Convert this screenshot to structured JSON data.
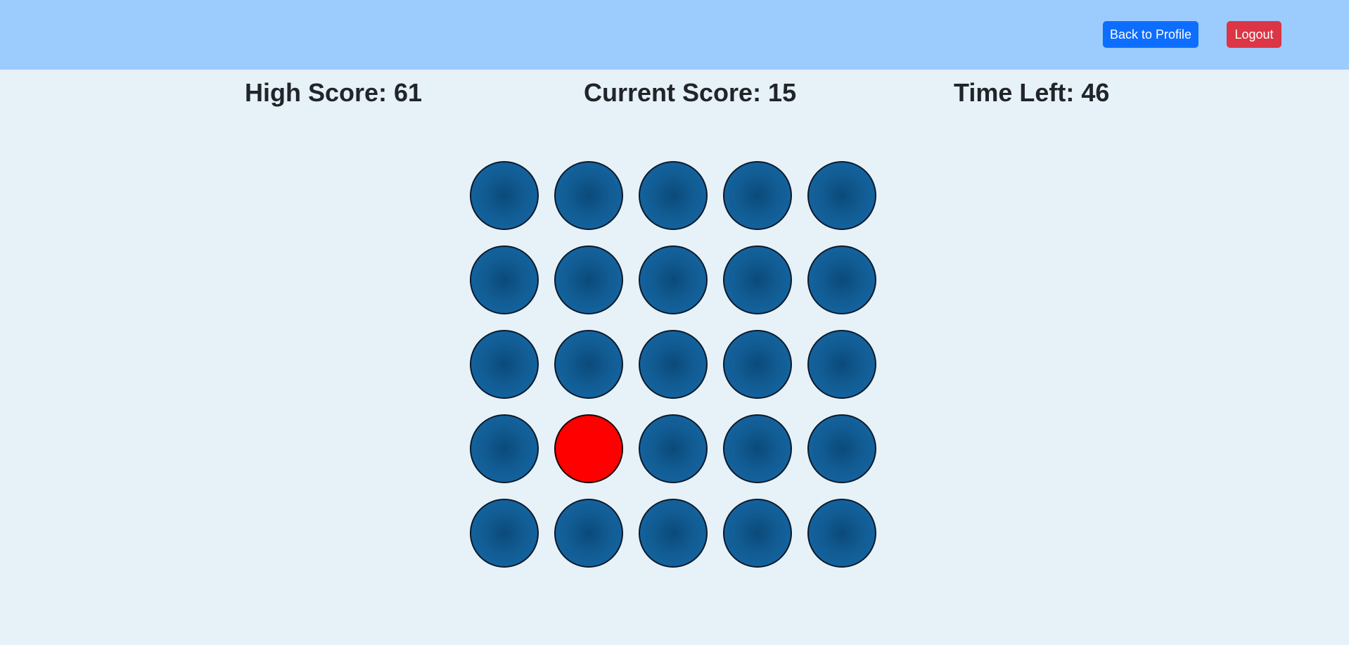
{
  "header": {
    "back_to_profile_label": "Back to Profile",
    "logout_label": "Logout"
  },
  "scores": {
    "high_score": "High Score: 61",
    "current_score": "Current Score: 15",
    "time_left": "Time Left: 46"
  },
  "board": {
    "rows": 5,
    "cols": 5,
    "active_cell": {
      "row": 4,
      "col": 2
    },
    "colors": {
      "idle": "#115c93",
      "active": "#ff0000"
    }
  },
  "colors": {
    "header_bg": "#9ccbfd",
    "page_bg": "#e6f1f8",
    "primary_button": "#0d6efd",
    "danger_button": "#dc3545"
  }
}
